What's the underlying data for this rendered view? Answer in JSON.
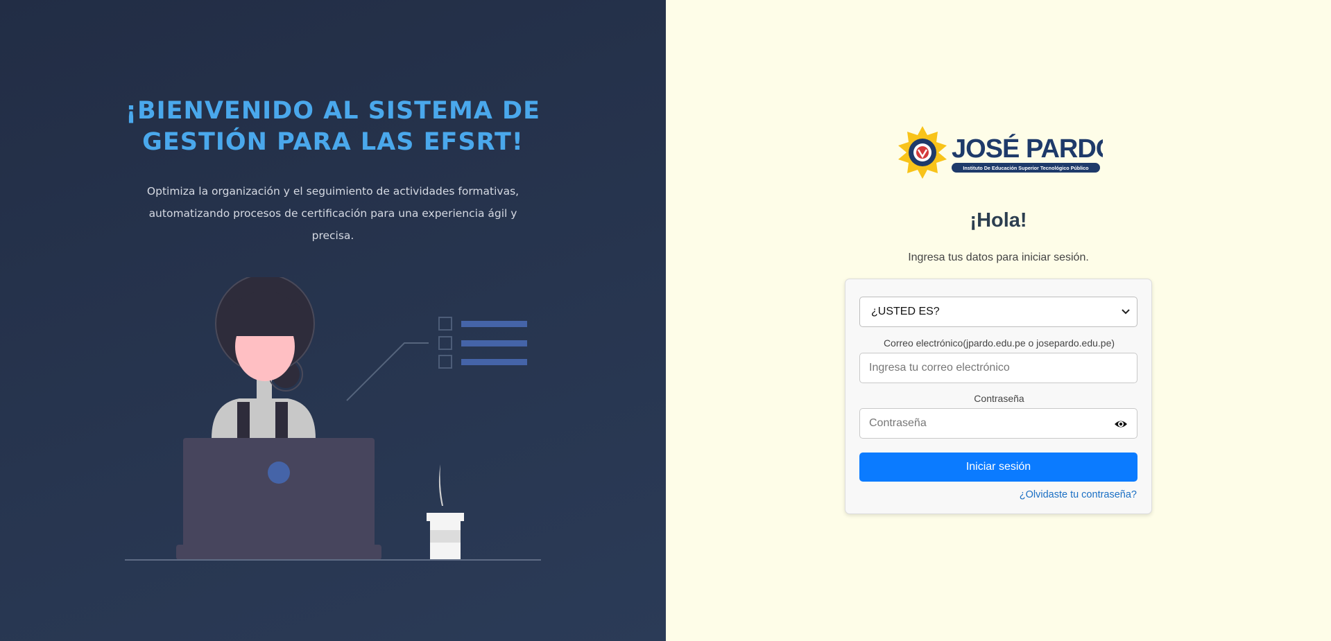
{
  "left_panel": {
    "title": "¡Bienvenido al sistema de gestión para las EFSRT!",
    "description": "Optimiza la organización y el seguimiento de actividades formativas, automatizando procesos de certificación para una experiencia ágil y precisa."
  },
  "logo": {
    "name": "JOSÉ PARDO",
    "tagline": "Instituto De Educación Superior Tecnológico Público"
  },
  "login": {
    "greeting": "¡Hola!",
    "subtitle": "Ingresa tus datos para iniciar sesión.",
    "role_select": {
      "selected": "¿USTED ES?"
    },
    "email_label": "Correo electrónico(jpardo.edu.pe o josepardo.edu.pe)",
    "email_placeholder": "Ingresa tu correo electrónico",
    "password_label": "Contraseña",
    "password_placeholder": "Contraseña",
    "submit_label": "Iniciar sesión",
    "forgot_label": "¿Olvidaste tu contraseña?"
  },
  "icons": {
    "dropdown": "chevron-down-icon",
    "password_toggle": "eye-icon"
  },
  "colors": {
    "left_bg": "#263350",
    "title_blue": "#4aa8ec",
    "right_bg": "#fefde8",
    "primary_button": "#0b7bff",
    "link": "#1a6fc4"
  }
}
